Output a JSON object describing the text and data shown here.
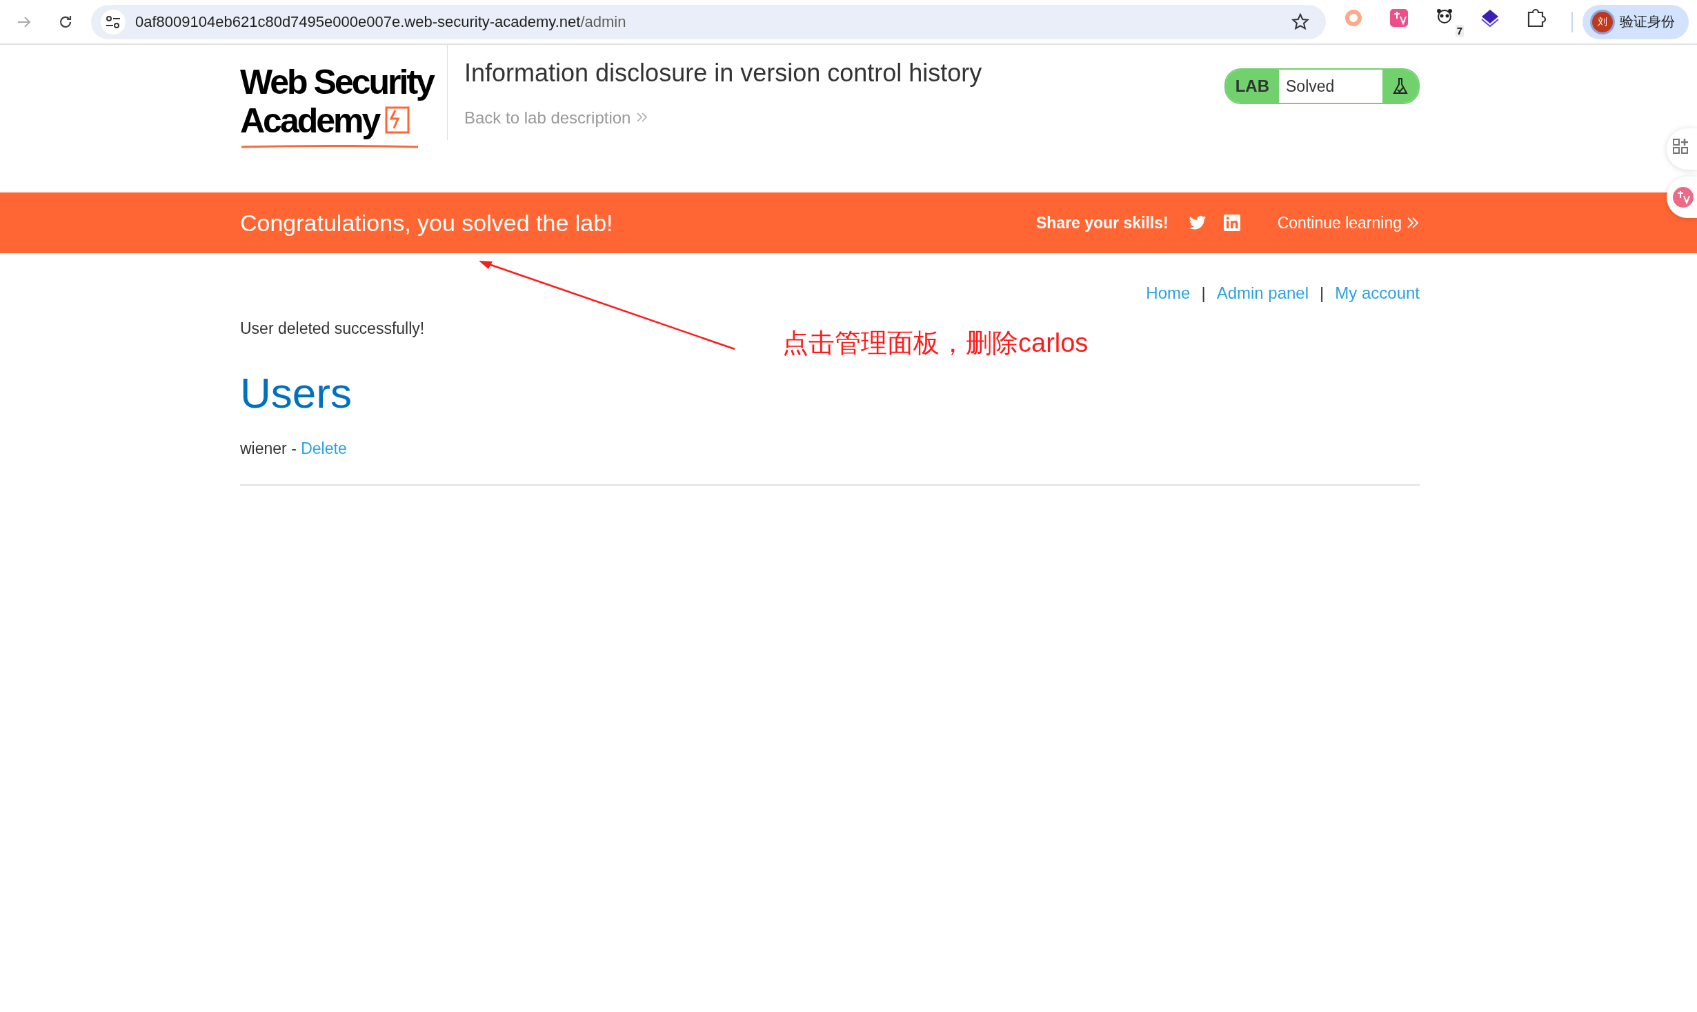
{
  "browser": {
    "forward_enabled": false,
    "url": {
      "host": "0af8009104eb621c80d7495e000e007e.web-security-academy.net",
      "path": "/admin"
    },
    "extensions": [
      {
        "kind": "ring"
      },
      {
        "kind": "translate"
      },
      {
        "kind": "panda",
        "badge": "7"
      },
      {
        "kind": "layers"
      },
      {
        "kind": "puzzle"
      }
    ],
    "profile": {
      "avatar_letter": "刘",
      "label": "验证身份"
    }
  },
  "header": {
    "logo_lines": [
      "Web Security",
      "Academy"
    ],
    "title": "Information disclosure in version control history",
    "back_link": "Back to lab description",
    "lab_status": {
      "label": "LAB",
      "status": "Solved",
      "solved": true
    }
  },
  "banner": {
    "message": "Congratulations, you solved the lab!",
    "share_label": "Share your skills!",
    "social": [
      {
        "kind": "twitter"
      },
      {
        "kind": "linkedin"
      }
    ],
    "continue_link": "Continue learning"
  },
  "nav_links": [
    "Home",
    "Admin panel",
    "My account"
  ],
  "nav_separator": "|",
  "message": "User deleted successfully!",
  "heading": "Users",
  "users": [
    {
      "name": "wiener",
      "separator": " - ",
      "action": "Delete"
    }
  ],
  "annotation": {
    "text": "点击管理面板，删除carlos"
  },
  "side_buttons": [
    {
      "kind": "apps"
    },
    {
      "kind": "translate"
    }
  ]
}
